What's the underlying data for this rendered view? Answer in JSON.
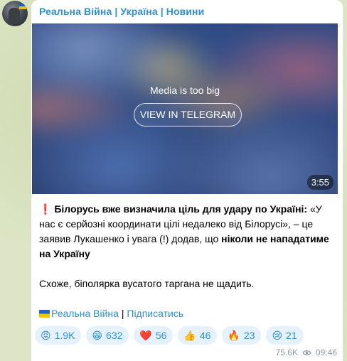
{
  "channel": {
    "title": "Реальна Війна | Україна | Новини"
  },
  "media": {
    "notice": "Media is too big",
    "button_label": "VIEW IN TELEGRAM",
    "duration": "3:55"
  },
  "post": {
    "bold_intro": "Білорусь вже визначила ціль для удару по Україні:",
    "quote_part1": "«У нас є серйозні координати цілі недалеко від Білорусі», – це заявив Лукашенко і увага (!) додав, що",
    "quote_bold": "ніколи не нападатиме на Україну",
    "paragraph2": "Схоже, біполярка вусатого таргана не щадить.",
    "link_channel": "Реальна Війна",
    "separator": "|",
    "link_subscribe": "Підписатись"
  },
  "reactions": [
    {
      "icon": "angry-face-icon",
      "emoji": "😡",
      "count": "1.9K"
    },
    {
      "icon": "grinning-face-icon",
      "emoji": "😁",
      "count": "632"
    },
    {
      "icon": "red-heart-icon",
      "emoji": "❤️",
      "count": "56"
    },
    {
      "icon": "thumbs-up-icon",
      "emoji": "👍",
      "count": "46"
    },
    {
      "icon": "fire-icon",
      "emoji": "🔥",
      "count": "23"
    },
    {
      "icon": "crying-face-icon",
      "emoji": "😢",
      "count": "21"
    }
  ],
  "meta": {
    "views": "75.6K",
    "time": "09:46"
  },
  "colors": {
    "accent": "#2f8fcf",
    "reaction_bg": "#e6f2fb",
    "chat_bg": "#dde5c6"
  }
}
